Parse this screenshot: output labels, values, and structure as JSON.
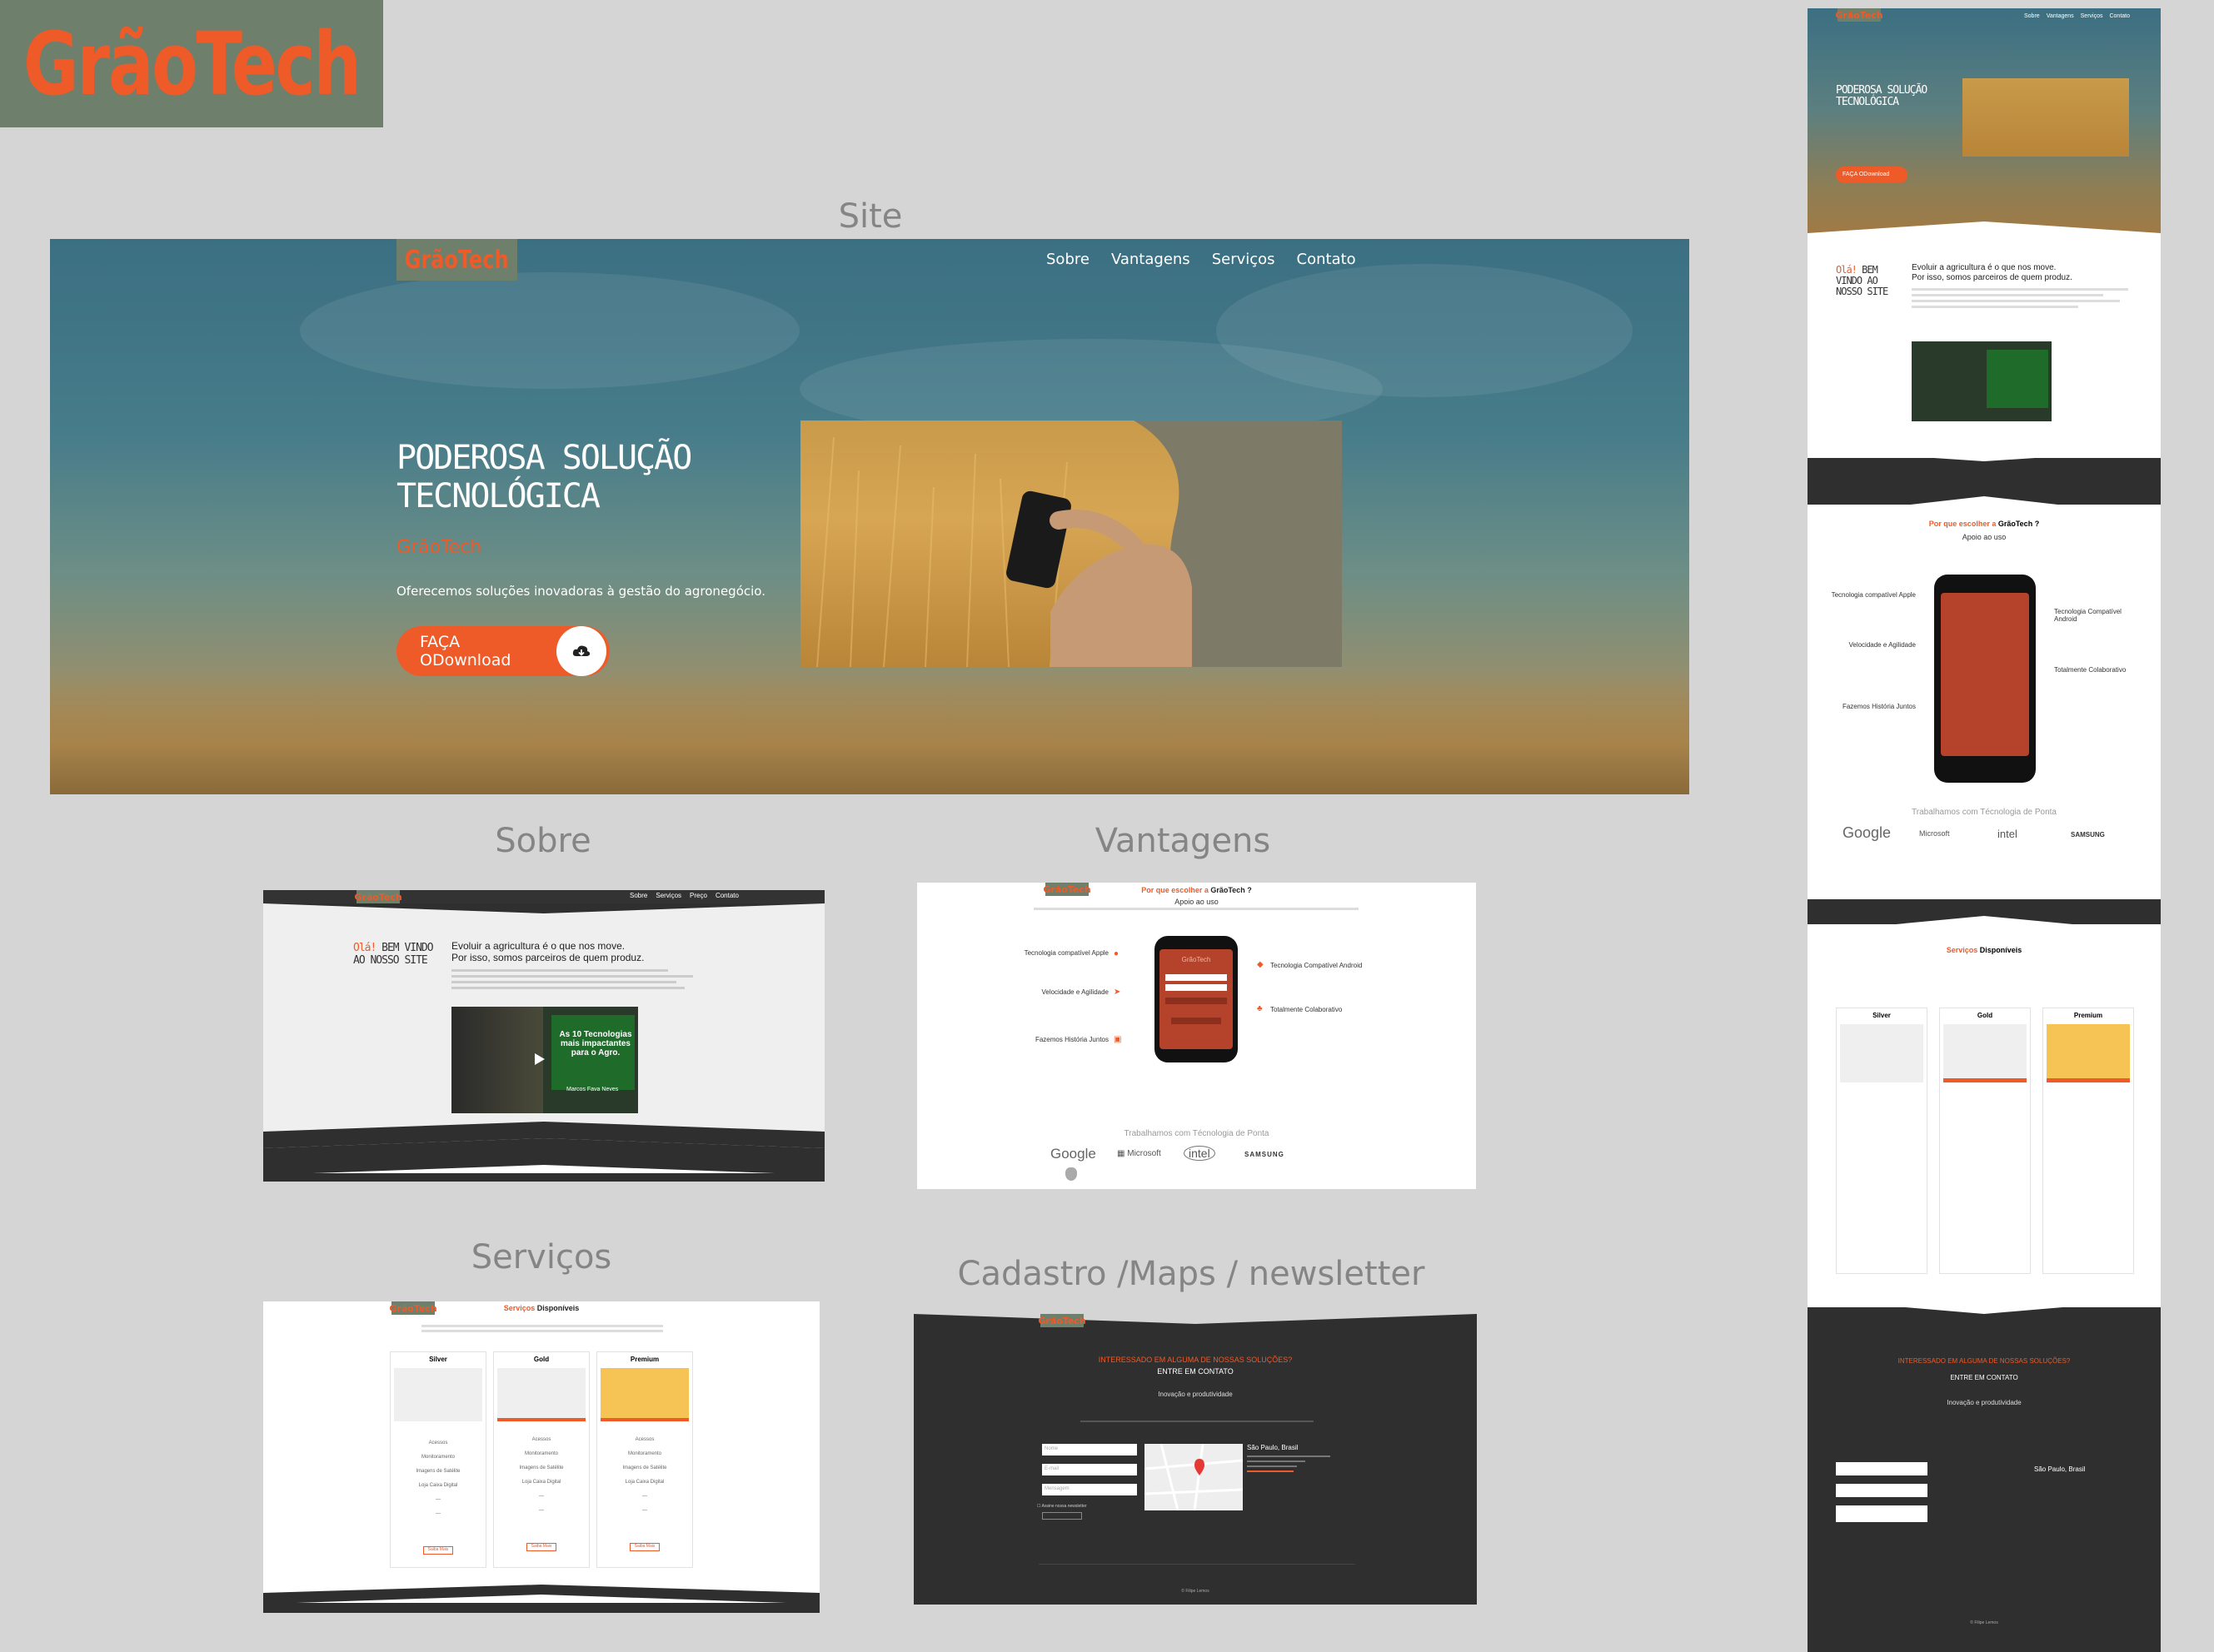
{
  "brand": "GrãoTech",
  "sections": {
    "site": "Site",
    "sobre": "Sobre",
    "vantagens": "Vantagens",
    "servicos": "Serviços",
    "cadastro": "Cadastro /Maps / newsletter"
  },
  "hero": {
    "logo": "GrãoTech",
    "nav": [
      "Sobre",
      "Vantagens",
      "Serviços",
      "Contato"
    ],
    "title_line1": "PODEROSA SOLUÇÃO",
    "title_line2": "TECNOLÓGICA",
    "subtitle": "GrãoTech",
    "description": "Oferecemos soluções inovadoras à gestão do agronegócio.",
    "button": "FAÇA ODownload"
  },
  "sobre": {
    "nav": [
      "Sobre",
      "Serviços",
      "Preço",
      "Contato"
    ],
    "welcome_orange": "Olá!",
    "welcome_rest_1": "BEM VINDO",
    "welcome_rest_2": "AO NOSSO SITE",
    "headline_1": "Evoluir a agricultura é o que nos move.",
    "headline_2": "Por isso, somos parceiros de quem produz.",
    "video_title": "As 10 Tecnologias mais impactantes para o Agro.",
    "video_presenter": "Marcos Fava Neves"
  },
  "vantagens": {
    "heading_orange": "Por que escolher a",
    "heading_brand": "GrãoTech ?",
    "sub": "Apoio ao uso",
    "features_left": [
      "Tecnologia compatível Apple",
      "Velocidade e Agilidade",
      "Fazemos História Juntos"
    ],
    "features_right": [
      "Tecnologia Compatível Android",
      "Totalmente Colaborativo"
    ],
    "partners_label": "Trabalhamos com Técnologia de Ponta",
    "partners": [
      "Google",
      "Microsoft",
      "intel",
      "SAMSUNG"
    ]
  },
  "servicos": {
    "heading_orange": "Serviços",
    "heading_rest": "Disponíveis",
    "plans": [
      "Silver",
      "Gold",
      "Premium"
    ],
    "features": [
      "Acessos",
      "Monitoramento",
      "Imagens de Satélite",
      "Loja Caixa Digital"
    ],
    "button": "Saiba Mais"
  },
  "cadastro": {
    "heading": "INTERESSADO EM ALGUMA DE NOSSAS SOLUÇÕES?",
    "sub": "ENTRE EM CONTATO",
    "tagline": "Inovação e produtividade",
    "fields": [
      "Nome",
      "E-mail",
      "Mensagem"
    ],
    "newsletter": "Assine nossa newsletter",
    "city": "São Paulo, Brasil",
    "footer": "© Filipe Lemos"
  },
  "side": {
    "hero_title_1": "PODEROSA SOLUÇÃO",
    "hero_title_2": "TECNOLÓGICA",
    "hero_button": "FAÇA ODownload",
    "welcome_1": "Olá! BEM",
    "welcome_2": "VINDO AO",
    "welcome_3": "NOSSO SITE",
    "headline_1": "Evoluir a agricultura é o que nos move.",
    "headline_2": "Por isso, somos parceiros de quem produz.",
    "why_orange": "Por que escolher a",
    "why_brand": "GrãoTech ?",
    "why_sub": "Apoio ao uso",
    "features_left": [
      "Tecnologia compatível Apple",
      "Velocidade e Agilidade",
      "Fazemos História Juntos"
    ],
    "features_right": [
      "Tecnologia Compatível Android",
      "Totalmente Colaborativo"
    ],
    "partners_label": "Trabalhamos com Técnologia de Ponta",
    "services_orange": "Serviços",
    "services_rest": "Disponíveis",
    "contact_heading": "INTERESSADO EM ALGUMA DE NOSSAS SOLUÇÕES?",
    "contact_sub": "ENTRE EM CONTATO",
    "contact_tagline": "Inovação e produtividade",
    "city": "São Paulo, Brasil",
    "footer": "© Filipe Lemos"
  }
}
